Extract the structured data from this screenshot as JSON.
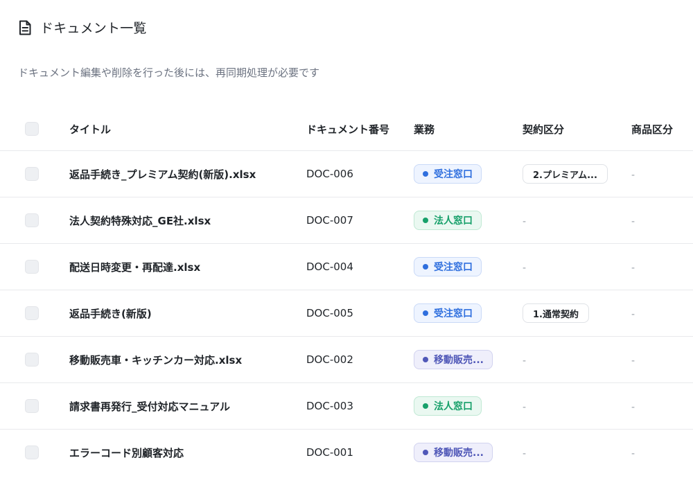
{
  "header": {
    "icon": "document-icon",
    "title": "ドキュメント一覧"
  },
  "notice": "ドキュメント編集や削除を行った後には、再同期処理が必要です",
  "table": {
    "columns": [
      "タイトル",
      "ドキュメント番号",
      "業務",
      "契約区分",
      "商品区分"
    ],
    "rows": [
      {
        "title": "返品手続き_プレミアム契約(新版).xlsx",
        "doc_no": "DOC-006",
        "business": "受注窓口",
        "business_color": "blue",
        "contract": "2.プレミアム...",
        "product": "-"
      },
      {
        "title": "法人契約特殊対応_GE社.xlsx",
        "doc_no": "DOC-007",
        "business": "法人窓口",
        "business_color": "green",
        "contract": "-",
        "product": "-"
      },
      {
        "title": "配送日時変更・再配達.xlsx",
        "doc_no": "DOC-004",
        "business": "受注窓口",
        "business_color": "blue",
        "contract": "-",
        "product": "-"
      },
      {
        "title": "返品手続き(新版)",
        "doc_no": "DOC-005",
        "business": "受注窓口",
        "business_color": "blue",
        "contract": "1.通常契約",
        "product": "-"
      },
      {
        "title": "移動販売車・キッチンカー対応.xlsx",
        "doc_no": "DOC-002",
        "business": "移動販売...",
        "business_color": "indigo",
        "contract": "-",
        "product": "-"
      },
      {
        "title": "請求書再発行_受付対応マニュアル",
        "doc_no": "DOC-003",
        "business": "法人窓口",
        "business_color": "green",
        "contract": "-",
        "product": "-"
      },
      {
        "title": "エラーコード別顧客対応",
        "doc_no": "DOC-001",
        "business": "移動販売...",
        "business_color": "indigo",
        "contract": "-",
        "product": "-"
      }
    ]
  },
  "colors": {
    "blue": "#2f6fde",
    "green": "#17a06a",
    "indigo": "#5058b8",
    "muted_text": "#6b7280"
  }
}
